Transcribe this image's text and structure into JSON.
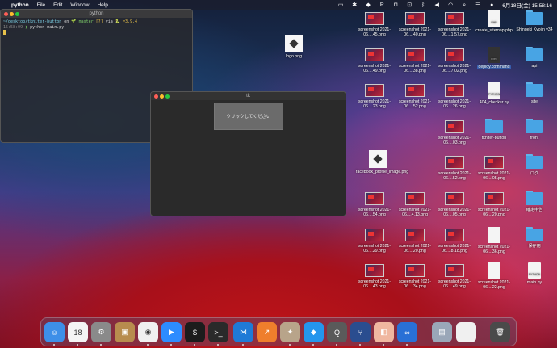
{
  "menubar": {
    "app": "python",
    "items": [
      "File",
      "Edit",
      "Window",
      "Help"
    ],
    "datetime": "6月18日(金)  15:58:16",
    "status_icons": [
      "display-icon",
      "bluetooth-icon",
      "dropbox-icon",
      "p-icon",
      "vpn-icon",
      "disk-icon",
      "bluetooth-icon",
      "volume-icon",
      "wifi-icon",
      "search-icon",
      "control-center-icon",
      "siri-icon"
    ]
  },
  "terminal": {
    "title": "python",
    "prompt_path": "~/desktop/tkniter-button",
    "prompt_on": "on",
    "branch": "master",
    "status": "[?]",
    "via": "via",
    "version": "v3.9.4",
    "time": "15:58:09",
    "command": "python main.py"
  },
  "tk_window": {
    "title": "tk",
    "button_label": "クリックしてください"
  },
  "desktop": {
    "logo": "logo.png",
    "facebook": "facebook_profile_image.png",
    "col1": [
      "screenshot 2021-06....45.png",
      "screenshot 2021-06....49.png",
      "screenshot 2021-06....23.png",
      "screenshot 2021-06....54.png",
      "screenshot 2021-06....29.png",
      "screenshot 2021-06....43.png"
    ],
    "col2": [
      "screenshot 2021-06....40.png",
      "screenshot 2021-06....38.png",
      "screenshot 2021-06....52.png",
      "screenshot 2021-06....4.13.png",
      "screenshot 2021-06....20.png",
      "screenshot 2021-06....34.png"
    ],
    "col3": [
      "screenshot 2021-06....1.57.png",
      "screenshot 2021-06....7.02.png",
      "screenshot 2021-06....26.png",
      "screenshot 2021-06....03.png",
      "screenshot 2021-06....52.png",
      "screenshot 2021-06....05.png",
      "screenshot 2021-06....8.18.png",
      "screenshot 2021-06....49.png"
    ],
    "col4": [
      "create_sitemap.php",
      "deploy.command",
      "404_checker.py",
      "tkniter-button",
      "screenshot 2021-06....05.png",
      "screenshot 2021-06....20.png",
      "screenshot 2021-06....36.png",
      "screenshot 2021-06....22.png"
    ],
    "col5": [
      "Shingeki Kyojin v34",
      "api",
      "site",
      "front",
      "ログ",
      "確定申告",
      "保存用",
      "main.py"
    ]
  },
  "dock": {
    "apps": [
      {
        "name": "finder",
        "color": "#3d8fe8",
        "glyph": "☺"
      },
      {
        "name": "calendar",
        "color": "#f4f4f4",
        "glyph": "18"
      },
      {
        "name": "system-preferences",
        "color": "#8a8a8a",
        "glyph": "⚙"
      },
      {
        "name": "contacts",
        "color": "#b88c4e",
        "glyph": "▣"
      },
      {
        "name": "chrome",
        "color": "#f0f0f0",
        "glyph": "◉"
      },
      {
        "name": "zoom",
        "color": "#2d8cff",
        "glyph": "▶"
      },
      {
        "name": "iterm",
        "color": "#1c1c1c",
        "glyph": "$"
      },
      {
        "name": "terminal",
        "color": "#2a2a2a",
        "glyph": ">_"
      },
      {
        "name": "vscode",
        "color": "#1f7ad6",
        "glyph": "⋈"
      },
      {
        "name": "tableplus",
        "color": "#ef7e2c",
        "glyph": "↗"
      },
      {
        "name": "python-launcher",
        "color": "#b8a48a",
        "glyph": "✦"
      },
      {
        "name": "docker",
        "color": "#2496ed",
        "glyph": "◆"
      },
      {
        "name": "quicktime",
        "color": "#5a5a5a",
        "glyph": "Q"
      },
      {
        "name": "sourcetree",
        "color": "#2a4d8f",
        "glyph": "⑂"
      },
      {
        "name": "sublime",
        "color": "#f0b7a0",
        "glyph": "◧"
      },
      {
        "name": "infinity",
        "color": "#2970d6",
        "glyph": "∞"
      },
      {
        "name": "preview",
        "color": "#9aa7b8",
        "glyph": "▤"
      },
      {
        "name": "document",
        "color": "#f0f0f0",
        "glyph": ""
      },
      {
        "name": "trash",
        "color": "#4a4a4a",
        "glyph": "🗑"
      }
    ]
  }
}
